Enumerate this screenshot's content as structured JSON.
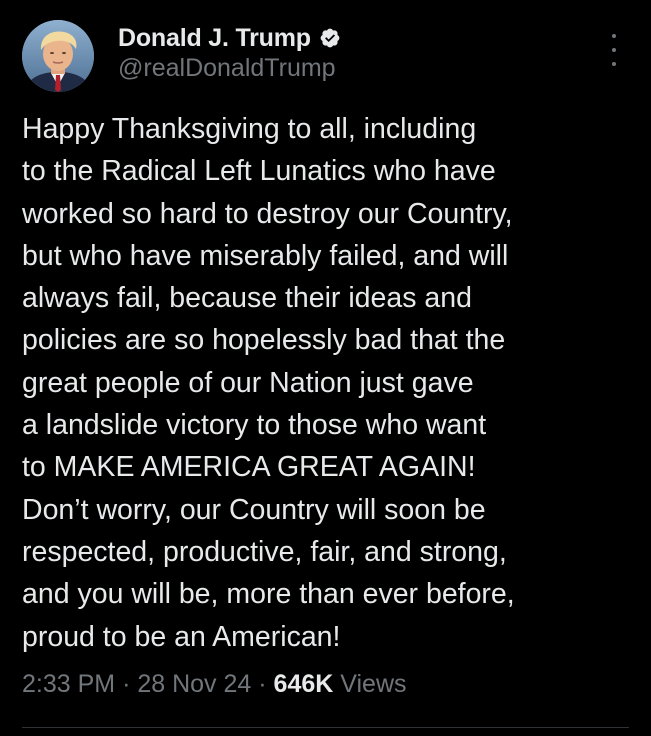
{
  "author": {
    "display_name": "Donald J. Trump",
    "handle": "@realDonaldTrump",
    "verified": true,
    "verified_color": "#1d9bf0"
  },
  "icons": {
    "verified": "verified-badge-icon",
    "more": "vertical-ellipsis-icon",
    "avatar": "profile-photo"
  },
  "tweet": {
    "lines": [
      "Happy Thanksgiving to all, including",
      "to the Radical Left Lunatics who have",
      "worked so hard to destroy our Country,",
      "but who have miserably failed, and will",
      "always fail, because their ideas and",
      "policies are so hopelessly bad that the",
      "great people of our Nation just gave",
      "a landslide victory to those who want",
      "to MAKE AMERICA GREAT AGAIN!",
      "Don’t worry, our Country will soon be",
      "respected, productive, fair, and strong,",
      "and you will be, more than ever before,",
      "proud to be an American!"
    ]
  },
  "meta": {
    "time": "2:33 PM",
    "separator": "·",
    "date": "28 Nov 24",
    "views_count": "646K",
    "views_label": "Views"
  },
  "colors": {
    "background": "#000000",
    "primary_text": "#e7e9ea",
    "secondary_text": "#71767b",
    "divider": "#2f3336"
  }
}
